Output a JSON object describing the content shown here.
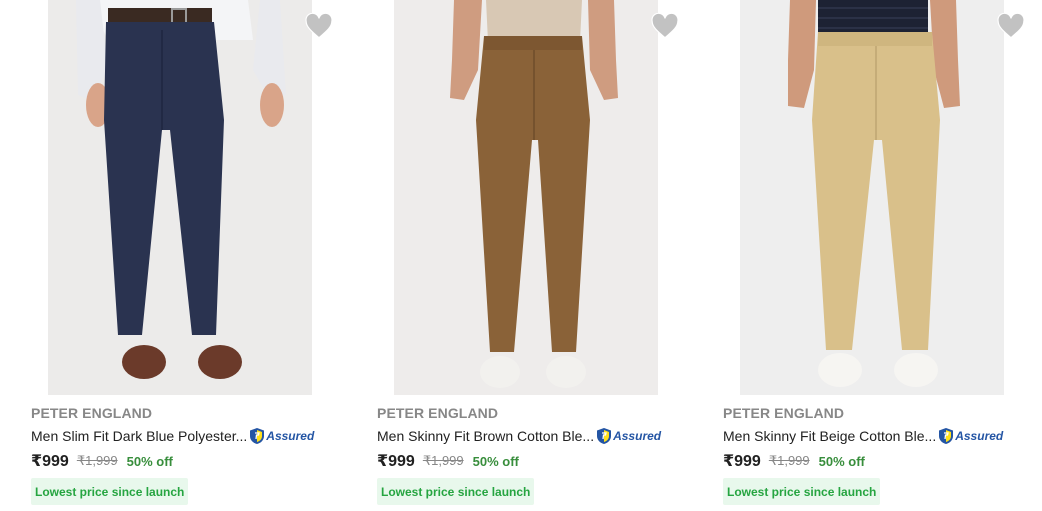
{
  "colors": {
    "brand_text": "#878787",
    "title_text": "#212121",
    "discount": "#388e3c",
    "assured_blue": "#2455a4",
    "tag_bg": "#e8f8ec",
    "tag_text": "#26a541"
  },
  "products": [
    {
      "brand": "PETER ENGLAND",
      "title": "Men Slim Fit Dark Blue Polyester...",
      "assured_label": "Assured",
      "price": "₹999",
      "mrp": "₹1,999",
      "discount": "50% off",
      "tag": "Lowest price since launch",
      "image_icon": "navy-trousers-image",
      "trouser_color": "#2a3350"
    },
    {
      "brand": "PETER ENGLAND",
      "title": "Men Skinny Fit Brown Cotton Ble...",
      "assured_label": "Assured",
      "price": "₹999",
      "mrp": "₹1,999",
      "discount": "50% off",
      "tag": "Lowest price since launch",
      "image_icon": "brown-chinos-image",
      "trouser_color": "#8a6238"
    },
    {
      "brand": "PETER ENGLAND",
      "title": "Men Skinny Fit Beige Cotton Ble...",
      "assured_label": "Assured",
      "price": "₹999",
      "mrp": "₹1,999",
      "discount": "50% off",
      "tag": "Lowest price since launch",
      "image_icon": "beige-chinos-image",
      "trouser_color": "#d9c08a"
    }
  ]
}
